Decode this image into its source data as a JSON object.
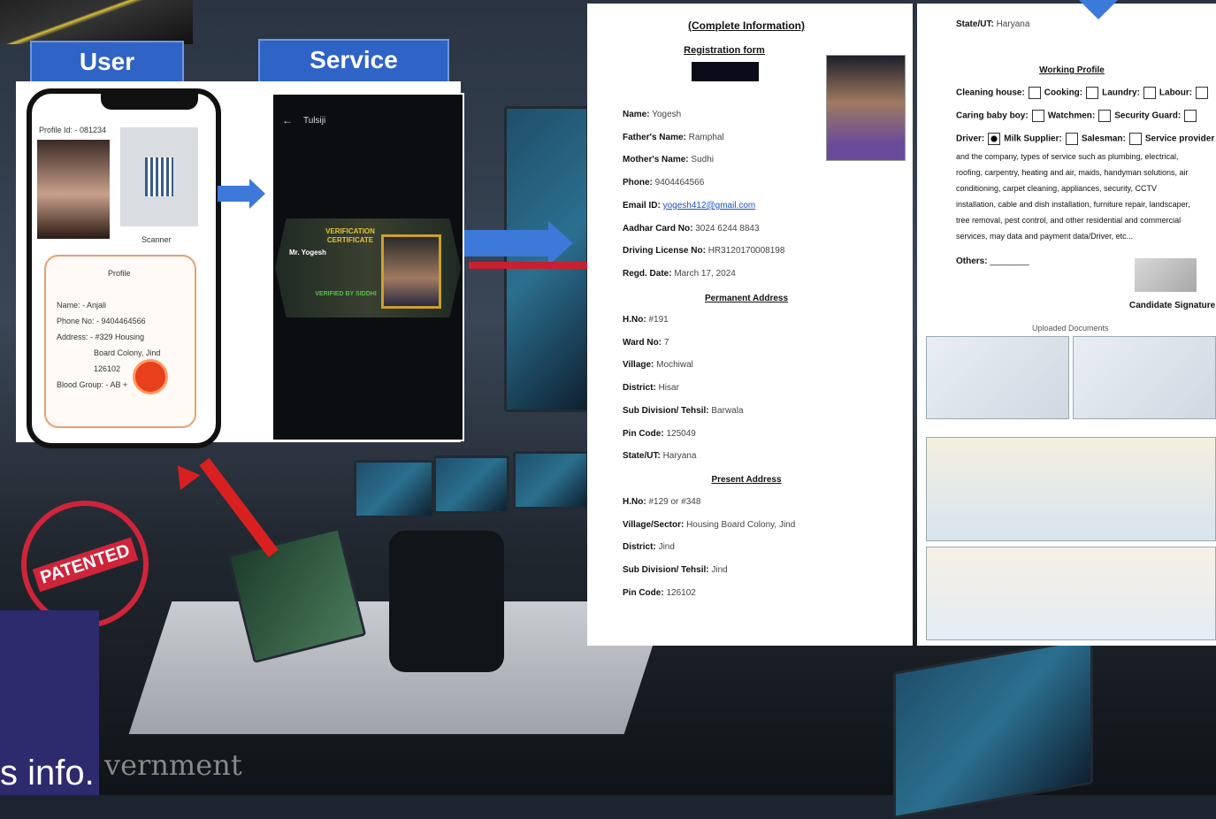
{
  "labels": {
    "user": "User",
    "service_provider": "Service Provider"
  },
  "phone": {
    "profile_id": "Profile Id: - 081234",
    "scanner": "Scanner",
    "card_title": "Profile",
    "name": "Name: - Anjali",
    "phone": "Phone No: - 9404464566",
    "address": "Address: - #329 Housing",
    "address2": "Board Colony, Jind",
    "address3": "126102",
    "blood": "Blood Group: - AB +"
  },
  "sp_screen": {
    "header": "Tulsiji",
    "cert_title": "VERIFICATION CERTIFICATE",
    "cert_name": "Mr. Yogesh",
    "cert_footer": "VERIFIED BY SIDDHI"
  },
  "form": {
    "heading": "(Complete Information)",
    "subheading": "Registration form",
    "fields": [
      {
        "label": "Name:",
        "value": "Yogesh"
      },
      {
        "label": "Father's Name:",
        "value": "Ramphal"
      },
      {
        "label": "Mother's Name:",
        "value": "Sudhi"
      },
      {
        "label": "Phone:",
        "value": "9404464566"
      },
      {
        "label": "Email ID:",
        "value": "yogesh412@gmail.com"
      },
      {
        "label": "Aadhar Card No:",
        "value": "3024 6244 8843"
      },
      {
        "label": "Driving License No:",
        "value": "HR3120170008198"
      },
      {
        "label": "Regd. Date:",
        "value": "March 17, 2024"
      }
    ],
    "permanent_heading": "Permanent Address",
    "permanent": [
      {
        "label": "H.No:",
        "value": "#191"
      },
      {
        "label": "Ward No:",
        "value": "7"
      },
      {
        "label": "Village:",
        "value": "Mochiwal"
      },
      {
        "label": "District:",
        "value": "Hisar"
      },
      {
        "label": "Sub Division/ Tehsil:",
        "value": "Barwala"
      },
      {
        "label": "Pin Code:",
        "value": "125049"
      },
      {
        "label": "State/UT:",
        "value": "Haryana"
      }
    ],
    "present_heading": "Present Address",
    "present": [
      {
        "label": "H.No:",
        "value": "#129 or #348"
      },
      {
        "label": "Village/Sector:",
        "value": "Housing Board Colony, Jind"
      },
      {
        "label": "District:",
        "value": "Jind"
      },
      {
        "label": "Sub Division/ Tehsil:",
        "value": "Jind"
      },
      {
        "label": "Pin Code:",
        "value": "126102"
      }
    ]
  },
  "form2": {
    "state_label": "State/UT:",
    "state_value": "Haryana",
    "working_heading": "Working Profile",
    "row1": [
      "Cleaning house:",
      "Cooking:",
      "Laundry:",
      "Labour:"
    ],
    "row2": [
      "Caring baby boy:",
      "Watchmen:",
      "Security Guard:"
    ],
    "row3": [
      "Driver:",
      "Milk Supplier:",
      "Salesman:",
      "Service provider"
    ],
    "desc1": "and the company, types of service such as plumbing, electrical,",
    "desc2": "roofing, carpentry, heating and air, maids, handyman solutions, air",
    "desc3": "conditioning, carpet cleaning, appliances, security, CCTV",
    "desc4": "installation, cable and dish installation, furniture repair, landscaper,",
    "desc5": "tree removal, pest control, and other residential and commercial",
    "desc6": "services, may data and payment data/Driver, etc...",
    "others": "Others:",
    "signature_label": "Candidate Signature",
    "uploaded": "Uploaded Documents"
  },
  "stamp": {
    "text": "PATENTED"
  },
  "footer": {
    "info": "s info.",
    "overlay": "vernment"
  },
  "colors": {
    "accent_blue": "#2f63c6",
    "arrow_blue": "#3c79d8",
    "stamp_red": "#d0243a",
    "panel_purple": "#2d2a6e"
  }
}
